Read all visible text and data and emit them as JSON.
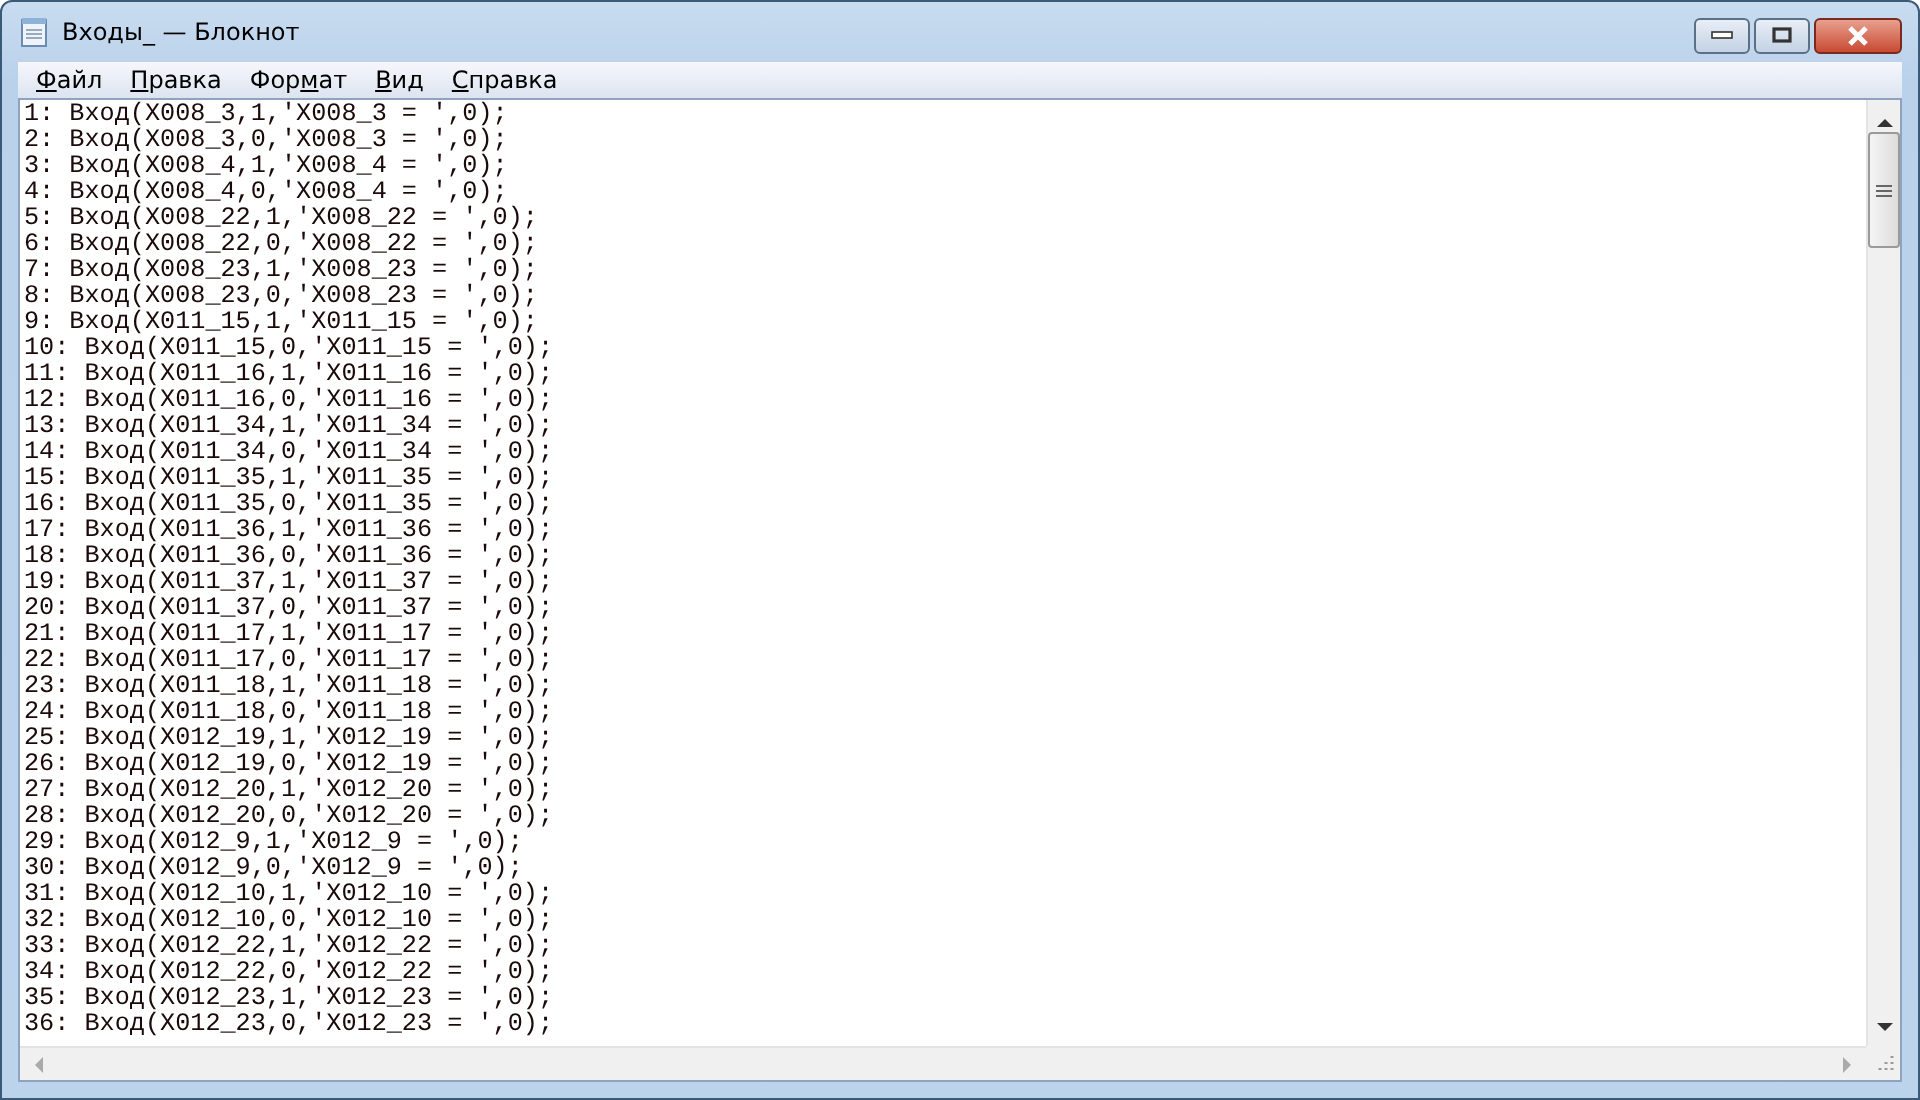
{
  "window": {
    "title": "Входы_ — Блокнот"
  },
  "menu": [
    {
      "key": "Ф",
      "after": "айл"
    },
    {
      "key": "П",
      "after": "равка"
    },
    {
      "before": "Фор",
      "key": "м",
      "after": "ат"
    },
    {
      "key": "В",
      "after": "ид"
    },
    {
      "key": "С",
      "after": "правка"
    }
  ],
  "editor": {
    "lines": [
      "1: Вход(X008_3,1,'X008_3 = ',0);",
      "2: Вход(X008_3,0,'X008_3 = ',0);",
      "3: Вход(X008_4,1,'X008_4 = ',0);",
      "4: Вход(X008_4,0,'X008_4 = ',0);",
      "5: Вход(X008_22,1,'X008_22 = ',0);",
      "6: Вход(X008_22,0,'X008_22 = ',0);",
      "7: Вход(X008_23,1,'X008_23 = ',0);",
      "8: Вход(X008_23,0,'X008_23 = ',0);",
      "9: Вход(X011_15,1,'X011_15 = ',0);",
      "10: Вход(X011_15,0,'X011_15 = ',0);",
      "11: Вход(X011_16,1,'X011_16 = ',0);",
      "12: Вход(X011_16,0,'X011_16 = ',0);",
      "13: Вход(X011_34,1,'X011_34 = ',0);",
      "14: Вход(X011_34,0,'X011_34 = ',0);",
      "15: Вход(X011_35,1,'X011_35 = ',0);",
      "16: Вход(X011_35,0,'X011_35 = ',0);",
      "17: Вход(X011_36,1,'X011_36 = ',0);",
      "18: Вход(X011_36,0,'X011_36 = ',0);",
      "19: Вход(X011_37,1,'X011_37 = ',0);",
      "20: Вход(X011_37,0,'X011_37 = ',0);",
      "21: Вход(X011_17,1,'X011_17 = ',0);",
      "22: Вход(X011_17,0,'X011_17 = ',0);",
      "23: Вход(X011_18,1,'X011_18 = ',0);",
      "24: Вход(X011_18,0,'X011_18 = ',0);",
      "25: Вход(X012_19,1,'X012_19 = ',0);",
      "26: Вход(X012_19,0,'X012_19 = ',0);",
      "27: Вход(X012_20,1,'X012_20 = ',0);",
      "28: Вход(X012_20,0,'X012_20 = ',0);",
      "29: Вход(X012_9,1,'X012_9 = ',0);",
      "30: Вход(X012_9,0,'X012_9 = ',0);",
      "31: Вход(X012_10,1,'X012_10 = ',0);",
      "32: Вход(X012_10,0,'X012_10 = ',0);",
      "33: Вход(X012_22,1,'X012_22 = ',0);",
      "34: Вход(X012_22,0,'X012_22 = ',0);",
      "35: Вход(X012_23,1,'X012_23 = ',0);",
      "36: Вход(X012_23,0,'X012_23 = ',0);"
    ]
  }
}
